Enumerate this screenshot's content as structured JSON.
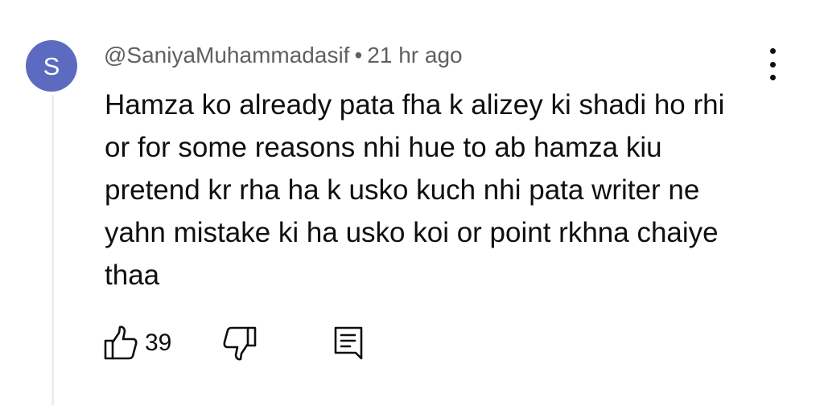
{
  "comment": {
    "avatar_letter": "S",
    "avatar_color": "#5c6bc0",
    "author": "@SaniyaMuhammadasif",
    "separator": "•",
    "timestamp": "21 hr ago",
    "body_lines": [
      "Hamza ko already pata fha k alizey ki shadi ho rhi",
      "or for some reasons nhi hue to ab hamza kiu",
      "pretend kr rha ha k usko kuch nhi pata writer ne",
      "yahn mistake ki ha usko koi or point rkhna chaiye",
      "thaa"
    ],
    "like_count": "39"
  },
  "icons": {
    "like": "thumbs-up-icon",
    "dislike": "thumbs-down-icon",
    "reply": "reply-comment-icon",
    "menu": "more-vertical-icon"
  }
}
